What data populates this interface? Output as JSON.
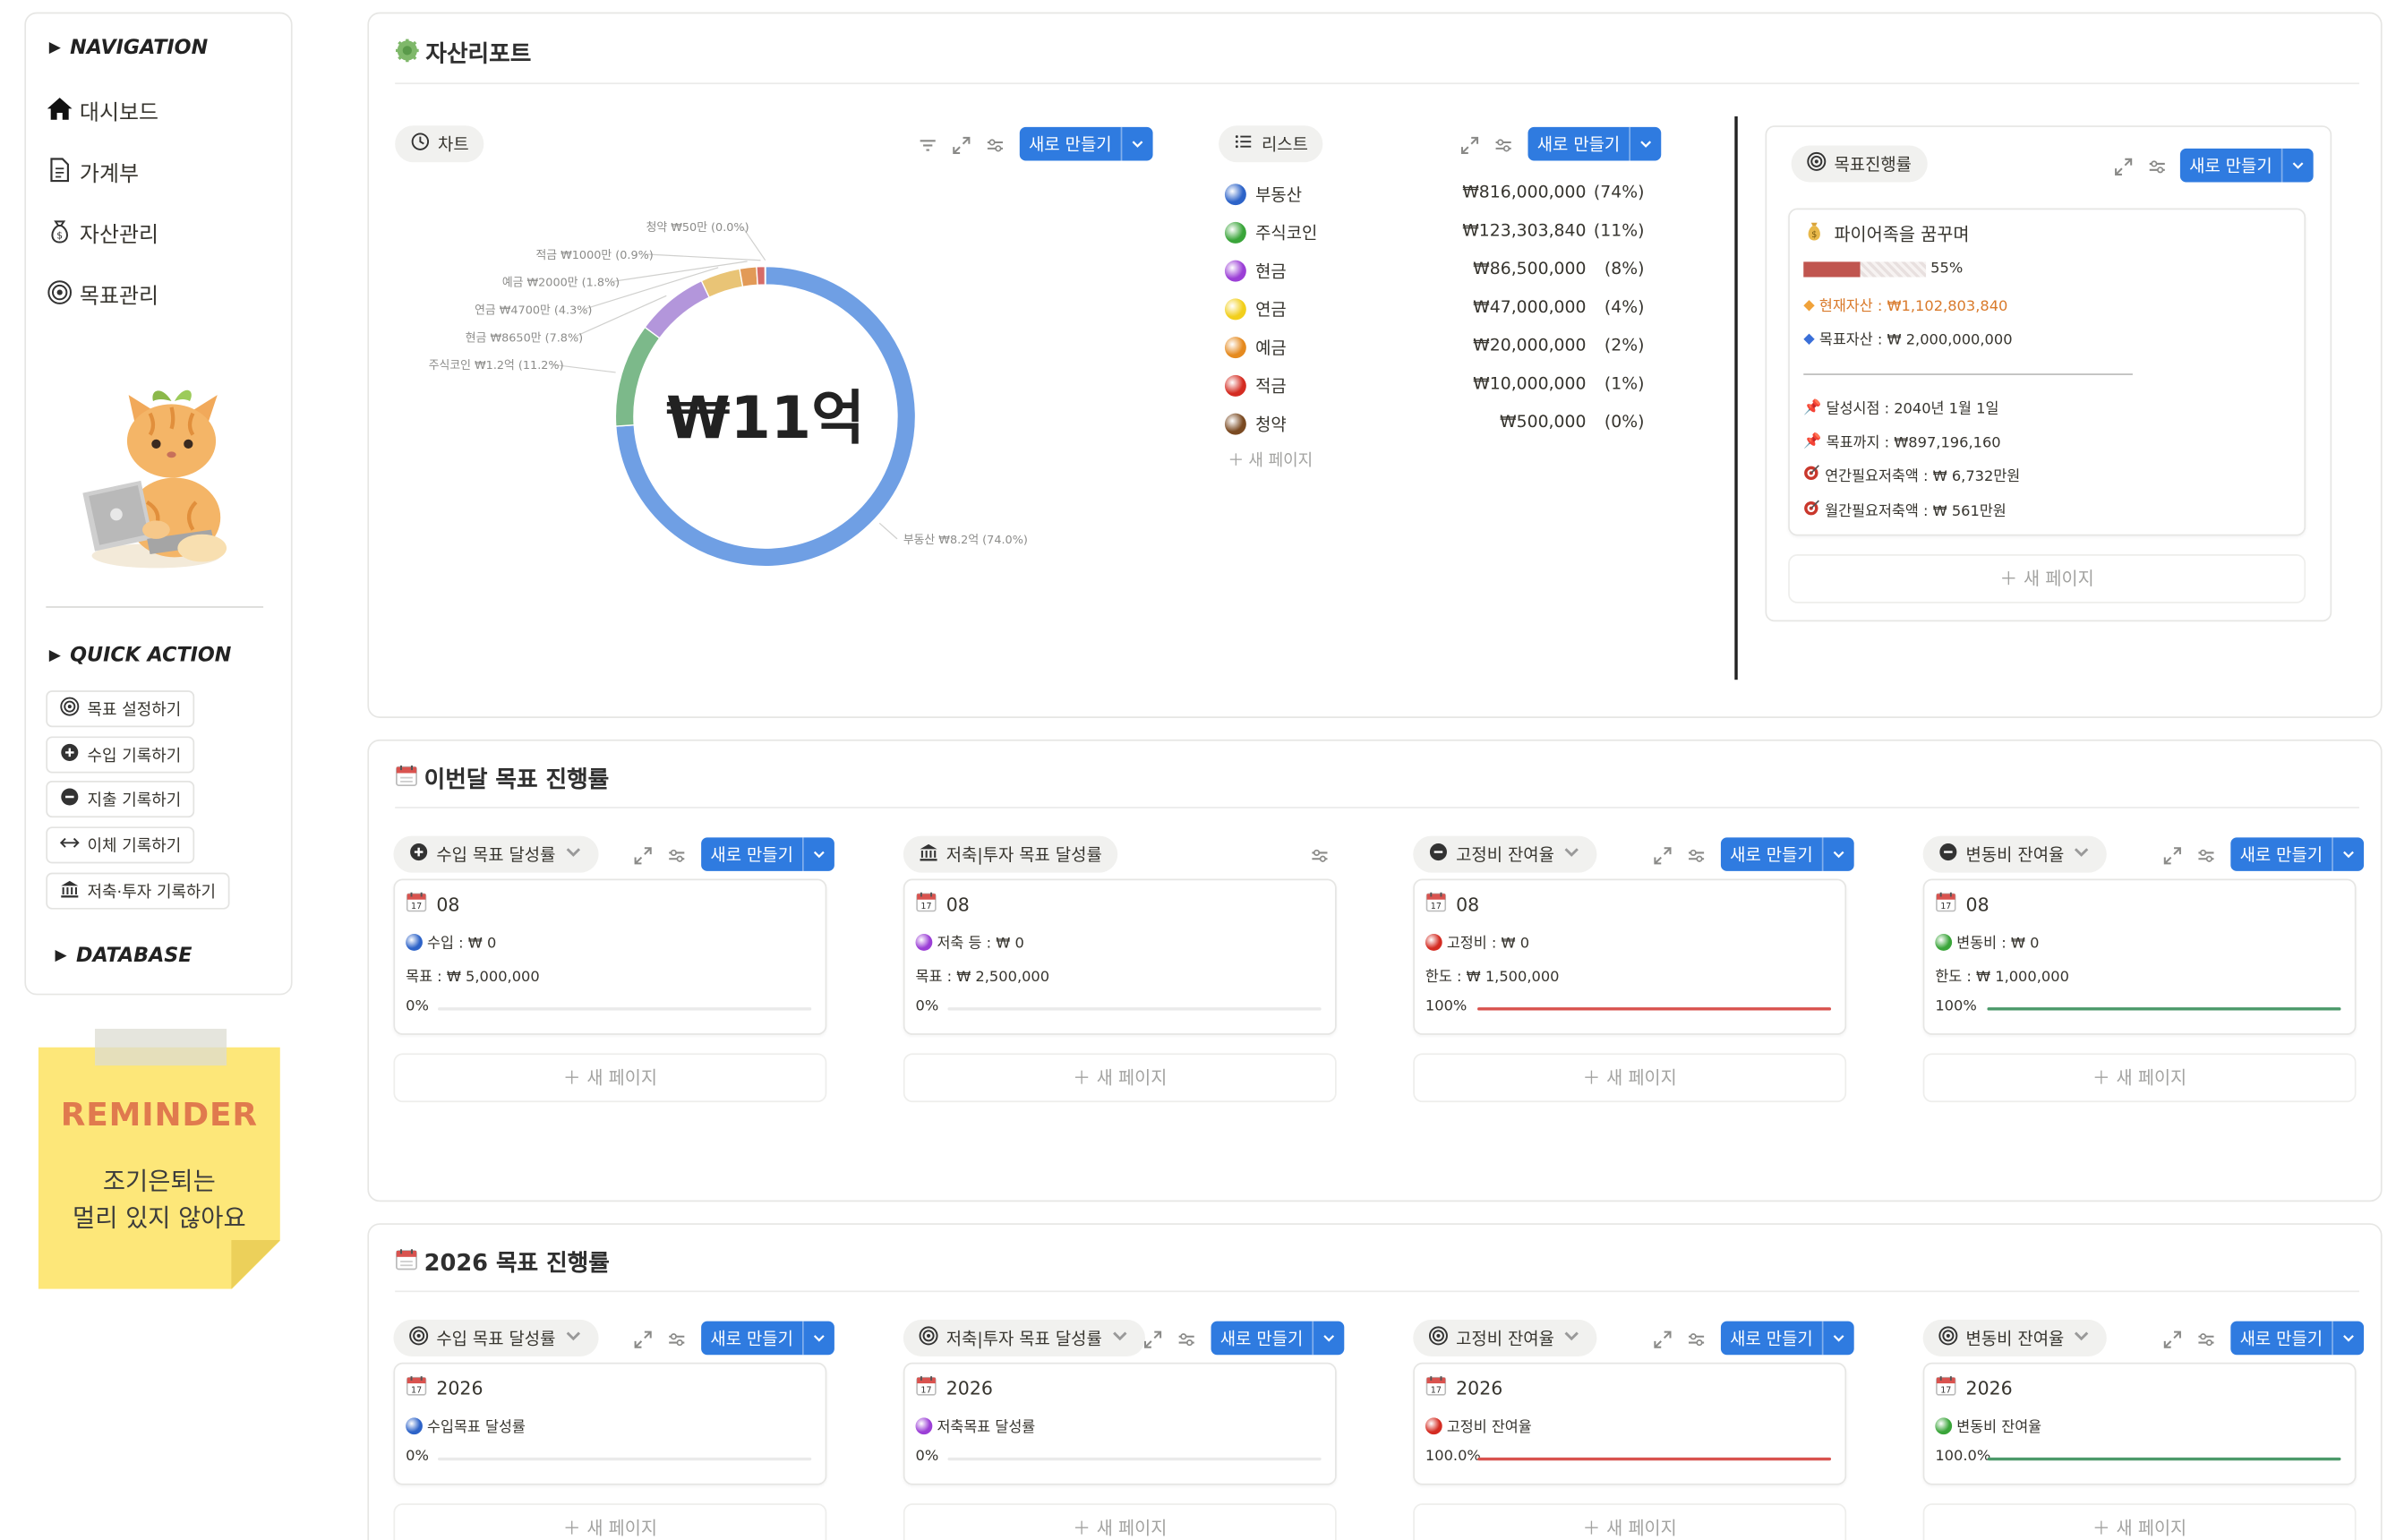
{
  "sidebar": {
    "navigation_header": "NAVIGATION",
    "nav_items": [
      {
        "label": "대시보드",
        "icon": "home-icon"
      },
      {
        "label": "가계부",
        "icon": "document-icon"
      },
      {
        "label": "자산관리",
        "icon": "money-bag-icon"
      },
      {
        "label": "목표관리",
        "icon": "target-icon"
      }
    ],
    "quick_action_header": "QUICK ACTION",
    "quick_actions": [
      {
        "label": "목표 설정하기",
        "icon": "target-icon"
      },
      {
        "label": "수입 기록하기",
        "icon": "plus-circle-icon"
      },
      {
        "label": "지출 기록하기",
        "icon": "minus-circle-icon"
      },
      {
        "label": "이체 기록하기",
        "icon": "transfer-icon"
      },
      {
        "label": "저축·투자 기록하기",
        "icon": "bank-icon"
      }
    ],
    "database_header": "DATABASE"
  },
  "reminder": {
    "title": "REMINDER",
    "line1": "조기은퇴는",
    "line2": "멀리 있지 않아요"
  },
  "asset_report": {
    "title": "자산리포트",
    "chart_view": {
      "label": "차트",
      "new_label": "새로 만들기",
      "center_text": "₩11억"
    },
    "list_view": {
      "label": "리스트",
      "new_label": "새로 만들기",
      "new_page": "새 페이지"
    },
    "assets": [
      {
        "name": "부동산",
        "amount": "₩816,000,000",
        "pct": "(74%)",
        "color": "#2d63c8"
      },
      {
        "name": "주식코인",
        "amount": "₩123,303,840",
        "pct": "(11%)",
        "color": "#3aa53a"
      },
      {
        "name": "현금",
        "amount": "₩86,500,000",
        "pct": "(8%)",
        "color": "#9b3fd6"
      },
      {
        "name": "연금",
        "amount": "₩47,000,000",
        "pct": "(4%)",
        "color": "#f2cf1c"
      },
      {
        "name": "예금",
        "amount": "₩20,000,000",
        "pct": "(2%)",
        "color": "#e58a1f"
      },
      {
        "name": "적금",
        "amount": "₩10,000,000",
        "pct": "(1%)",
        "color": "#d42c22"
      },
      {
        "name": "청약",
        "amount": "₩500,000",
        "pct": "(0%)",
        "color": "#7a4a22"
      }
    ],
    "goal_view": {
      "label": "목표진행률",
      "new_label": "새로 만들기",
      "card_title": "파이어족을 꿈꾸며",
      "progress_text": "55%",
      "progress": 0.55,
      "current_asset": "현재자산 : ₩1,102,803,840",
      "target_asset": "목표자산 : ₩ 2,000,000,000",
      "achieve_date": "달성시점 : 2040년 1월 1일",
      "remaining": "목표까지 : ₩897,196,160",
      "annual_saving": "연간필요저축액 : ₩ 6,732만원",
      "monthly_saving": "월간필요저축액 : ₩ 561만원",
      "new_page": "새 페이지"
    }
  },
  "chart_data": {
    "type": "pie",
    "donut": true,
    "categories": [
      "부동산",
      "주식코인",
      "현금",
      "연금",
      "예금",
      "적금",
      "청약"
    ],
    "values": [
      816000000,
      123303840,
      86500000,
      47000000,
      20000000,
      10000000,
      500000
    ],
    "colors": [
      "#6f9fe4",
      "#7cb98a",
      "#b396db",
      "#e9c476",
      "#e29a57",
      "#d66c68",
      "#a77b55"
    ],
    "labels": [
      "부동산 ₩8.2억 (74.0%)",
      "주식코인 ₩1.2억 (11.2%)",
      "현금 ₩8650만 (7.8%)",
      "연금 ₩4700만 (4.3%)",
      "예금 ₩2000만 (1.8%)",
      "적금 ₩1000만 (0.9%)",
      "청약 ₩50만 (0.0%)"
    ],
    "center_text": "₩11억"
  },
  "monthly": {
    "title": "이번달 목표 진행률",
    "new_page": "새 페이지",
    "boards": [
      {
        "label": "수입 목표 달성률",
        "has_new": true,
        "date": "08",
        "line1": "수입 : ₩ 0",
        "line2": "목표 : ₩ 5,000,000",
        "pct": "0%",
        "progress": 0,
        "color": "#2d63c8",
        "bar": "#dddddd"
      },
      {
        "label": "저축|투자 목표 달성률",
        "has_new": false,
        "date": "08",
        "line1": "저축 등 : ₩ 0",
        "line2": "목표 : ₩ 2,500,000",
        "pct": "0%",
        "progress": 0,
        "color": "#9b3fd6",
        "bar": "#dddddd"
      },
      {
        "label": "고정비 잔여율",
        "has_new": true,
        "date": "08",
        "line1": "고정비 : ₩ 0",
        "line2": "한도 : ₩ 1,500,000",
        "pct": "100%",
        "progress": 1,
        "color": "#d42c22",
        "bar": "#d9534f"
      },
      {
        "label": "변동비 잔여율",
        "has_new": true,
        "date": "08",
        "line1": "변동비 : ₩ 0",
        "line2": "한도 : ₩ 1,000,000",
        "pct": "100%",
        "progress": 1,
        "color": "#3aa53a",
        "bar": "#4c9a6a"
      }
    ],
    "new_label": "새로 만들기"
  },
  "yearly": {
    "title": "2026 목표 진행률",
    "new_page": "새 페이지",
    "new_label": "새로 만들기",
    "boards": [
      {
        "label": "수입 목표 달성률",
        "date": "2026",
        "line1": "수입목표 달성률",
        "pct": "0%",
        "progress": 0,
        "color": "#2d63c8",
        "bar": "#dddddd"
      },
      {
        "label": "저축|투자 목표 달성률",
        "date": "2026",
        "line1": "저축목표 달성률",
        "pct": "0%",
        "progress": 0,
        "color": "#9b3fd6",
        "bar": "#dddddd"
      },
      {
        "label": "고정비 잔여율",
        "date": "2026",
        "line1": "고정비 잔여율",
        "pct": "100.0%",
        "progress": 1,
        "color": "#d42c22",
        "bar": "#d9534f"
      },
      {
        "label": "변동비 잔여율",
        "date": "2026",
        "line1": "변동비 잔여율",
        "pct": "100.0%",
        "progress": 1,
        "color": "#3aa53a",
        "bar": "#4c9a6a"
      }
    ]
  }
}
